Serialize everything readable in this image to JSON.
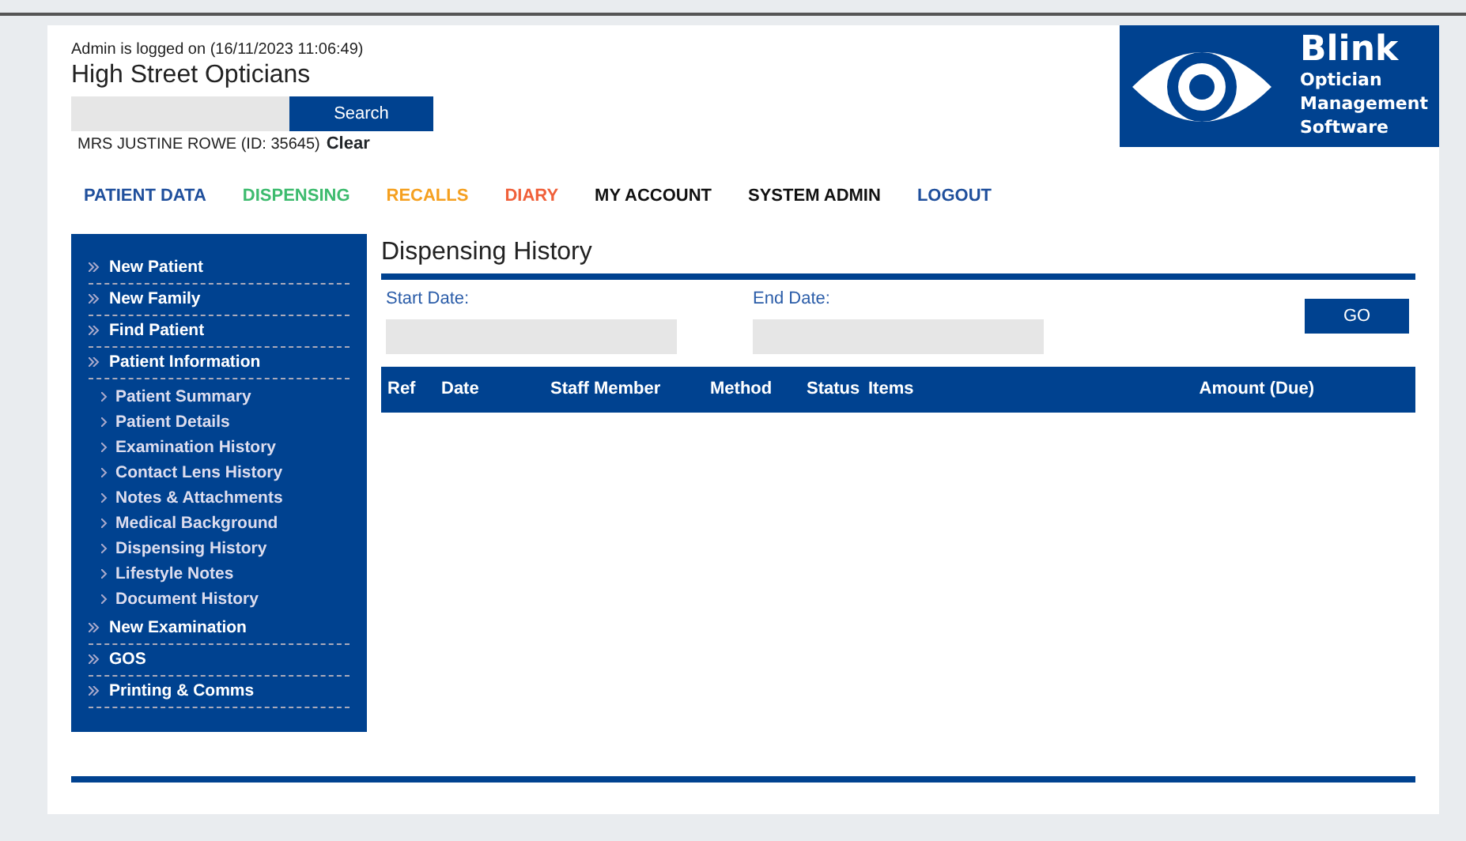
{
  "header": {
    "login_status": "Admin is logged on (16/11/2023 11:06:49)",
    "practice_name": "High Street Opticians",
    "search": {
      "button": "Search"
    },
    "patient": "MRS JUSTINE ROWE (ID: 35645)",
    "clear": "Clear"
  },
  "logo": {
    "name": "Blink",
    "tagline": [
      "Optician",
      "Management",
      "Software"
    ]
  },
  "nav": [
    {
      "label": "PATIENT DATA",
      "color": "#1f4f9c"
    },
    {
      "label": "DISPENSING",
      "color": "#3dbb6e"
    },
    {
      "label": "RECALLS",
      "color": "#f5a020"
    },
    {
      "label": "DIARY",
      "color": "#f0603a"
    },
    {
      "label": "MY ACCOUNT",
      "color": "#111111"
    },
    {
      "label": "SYSTEM ADMIN",
      "color": "#111111"
    },
    {
      "label": "LOGOUT",
      "color": "#1f4f9c"
    }
  ],
  "sidebar": {
    "items": [
      {
        "label": "New Patient"
      },
      {
        "label": "New Family"
      },
      {
        "label": "Find Patient"
      },
      {
        "label": "Patient Information",
        "children": [
          {
            "label": "Patient Summary"
          },
          {
            "label": "Patient Details"
          },
          {
            "label": "Examination History"
          },
          {
            "label": "Contact Lens History"
          },
          {
            "label": "Notes & Attachments"
          },
          {
            "label": "Medical Background"
          },
          {
            "label": "Dispensing History"
          },
          {
            "label": "Lifestyle Notes"
          },
          {
            "label": "Document History"
          }
        ]
      },
      {
        "label": "New Examination"
      },
      {
        "label": "GOS"
      },
      {
        "label": "Printing & Comms"
      }
    ]
  },
  "main": {
    "title": "Dispensing History",
    "start_date": {
      "label": "Start Date:"
    },
    "end_date": {
      "label": "End Date:"
    },
    "go_button": "GO",
    "table": {
      "columns": [
        "Ref",
        "Date",
        "Staff Member",
        "Method",
        "Status",
        "Items",
        "Amount (Due)"
      ]
    }
  }
}
